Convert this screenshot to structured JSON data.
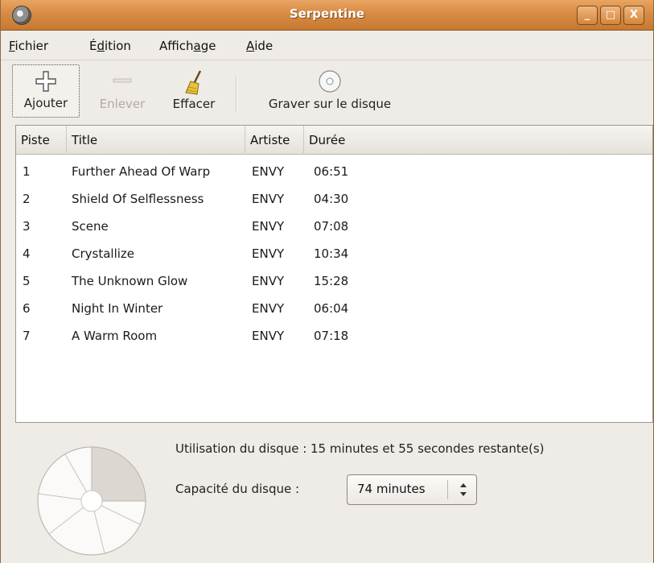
{
  "window": {
    "title": "Serpentine",
    "controls": {
      "minimize": "_",
      "maximize": "□",
      "close": "X"
    }
  },
  "menu": [
    {
      "label": "Fichier",
      "mnemonic": "F"
    },
    {
      "label": "Édition",
      "mnemonic": "d"
    },
    {
      "label": "Affichage",
      "mnemonic": "g"
    },
    {
      "label": "Aide",
      "mnemonic": "A"
    }
  ],
  "toolbar": {
    "add": {
      "label": "Ajouter",
      "icon": "plus-icon"
    },
    "remove": {
      "label": "Enlever",
      "icon": "minus-icon",
      "disabled": true
    },
    "clear": {
      "label": "Effacer",
      "icon": "broom-icon"
    },
    "burn": {
      "label": "Graver sur le disque",
      "icon": "cd-icon"
    }
  },
  "tracklist": {
    "columns": [
      "Piste",
      "Title",
      "Artiste",
      "Durée"
    ],
    "rows": [
      {
        "piste": "1",
        "title": "Further Ahead Of Warp",
        "artiste": "ENVY",
        "duree": "06:51"
      },
      {
        "piste": "2",
        "title": "Shield Of Selflessness",
        "artiste": "ENVY",
        "duree": "04:30"
      },
      {
        "piste": "3",
        "title": "Scene",
        "artiste": "ENVY",
        "duree": "07:08"
      },
      {
        "piste": "4",
        "title": "Crystallize",
        "artiste": "ENVY",
        "duree": "10:34"
      },
      {
        "piste": "5",
        "title": "The Unknown Glow",
        "artiste": "ENVY",
        "duree": "15:28"
      },
      {
        "piste": "6",
        "title": "Night In Winter",
        "artiste": "ENVY",
        "duree": "06:04"
      },
      {
        "piste": "7",
        "title": "A Warm Room",
        "artiste": "ENVY",
        "duree": "07:18"
      }
    ]
  },
  "disc": {
    "usage_label": "Utilisation du disque :  15 minutes et 55 secondes restante(s)",
    "capacity_label": "Capacité du disque :",
    "capacity_value": "74 minutes"
  },
  "colors": {
    "titlebar": "#d78b44",
    "window_bg": "#efebe7",
    "disc_used": "#dcd8d1"
  }
}
